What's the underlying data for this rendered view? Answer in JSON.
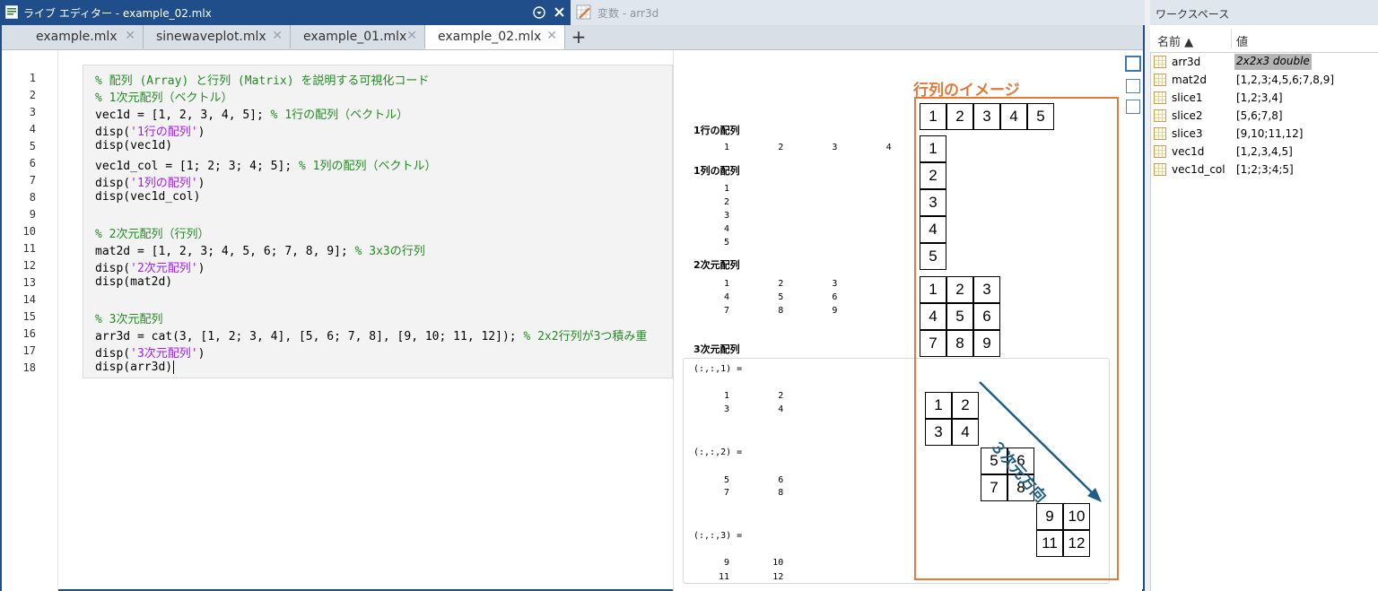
{
  "editor": {
    "window_title": "ライブ エディター - example_02.mlx",
    "variables_title": "変数 - arr3d",
    "tabs": [
      {
        "label": "example.mlx"
      },
      {
        "label": "sinewaveplot.mlx"
      },
      {
        "label": "example_01.mlx"
      },
      {
        "label": "example_02.mlx"
      }
    ],
    "tab_close": "✕",
    "tab_add": "+",
    "line_numbers": [
      "1",
      "2",
      "3",
      "4",
      "5",
      "6",
      "7",
      "8",
      "9",
      "10",
      "11",
      "12",
      "13",
      "14",
      "15",
      "16",
      "17",
      "18"
    ],
    "code": {
      "l1": "% 配列 (Array) と行列 (Matrix) を説明する可視化コード",
      "l2": "% 1次元配列（ベクトル）",
      "l3_code": "vec1d = [1, 2, 3, 4, 5]; ",
      "l3_comment": "% 1行の配列（ベクトル）",
      "l4_pre": "disp(",
      "l4_str": "'1行の配列'",
      "l4_post": ")",
      "l5": "disp(vec1d)",
      "l6_code": "vec1d_col = [1; 2; 3; 4; 5]; ",
      "l6_comment": "% 1列の配列（ベクトル）",
      "l7_pre": "disp(",
      "l7_str": "'1列の配列'",
      "l7_post": ")",
      "l8": "disp(vec1d_col)",
      "l10": "% 2次元配列（行列）",
      "l11_code": "mat2d = [1, 2, 3; 4, 5, 6; 7, 8, 9]; ",
      "l11_comment": "% 3x3の行列",
      "l12_pre": "disp(",
      "l12_str": "'2次元配列'",
      "l12_post": ")",
      "l13": "disp(mat2d)",
      "l15": "% 3次元配列",
      "l16_code": "arr3d = cat(3, [1, 2; 3, 4], [5, 6; 7, 8], [9, 10; 11, 12]); ",
      "l16_comment": "% 2x2行列が3つ積み重",
      "l17_pre": "disp(",
      "l17_str": "'3次元配列'",
      "l17_post": ")",
      "l18": "disp(arr3d)"
    }
  },
  "output": {
    "label_1row": "1行の配列",
    "vec1d": "1         2         3         4         5",
    "label_1col": "1列の配列",
    "vec1d_col": [
      "1",
      "2",
      "3",
      "4",
      "5"
    ],
    "label_2d": "2次元配列",
    "mat2d": [
      "1         2         3",
      "4         5         6",
      "7         8         9"
    ],
    "label_3d": "3次元配列",
    "page1_label": "(:,:,1) =",
    "page1": [
      "1         2",
      "3         4"
    ],
    "page2_label": "(:,:,2) =",
    "page2": [
      "5         6",
      "7         8"
    ],
    "page3_label": "(:,:,3) =",
    "page3": [
      "9        10",
      "11        12"
    ]
  },
  "diagram": {
    "title": "行列のイメージ",
    "row_vector": [
      "1",
      "2",
      "3",
      "4",
      "5"
    ],
    "col_vector": [
      "1",
      "2",
      "3",
      "4",
      "5"
    ],
    "matrix": [
      "1",
      "2",
      "3",
      "4",
      "5",
      "6",
      "7",
      "8",
      "9"
    ],
    "page1": [
      "1",
      "2",
      "3",
      "4"
    ],
    "page2": [
      "5",
      "6",
      "7",
      "8"
    ],
    "page3": [
      "9",
      "10",
      "11",
      "12"
    ],
    "arrow_label": "３次元方向"
  },
  "workspace": {
    "title": "ワークスペース",
    "col_name": "名前 ▲",
    "col_value": "値",
    "rows": [
      {
        "name": "arr3d",
        "value": "2x2x3 double"
      },
      {
        "name": "mat2d",
        "value": "[1,2,3;4,5,6;7,8,9]"
      },
      {
        "name": "slice1",
        "value": "[1,2;3,4]"
      },
      {
        "name": "slice2",
        "value": "[5,6;7,8]"
      },
      {
        "name": "slice3",
        "value": "[9,10;11,12]"
      },
      {
        "name": "vec1d",
        "value": "[1,2,3,4,5]"
      },
      {
        "name": "vec1d_col",
        "value": "[1;2;3;4;5]"
      }
    ]
  },
  "colors": {
    "accent": "#1f4e8a",
    "comment": "#228b22",
    "string": "#a020f0",
    "diagram_frame": "#e07b39",
    "arrow": "#1f5f86"
  }
}
